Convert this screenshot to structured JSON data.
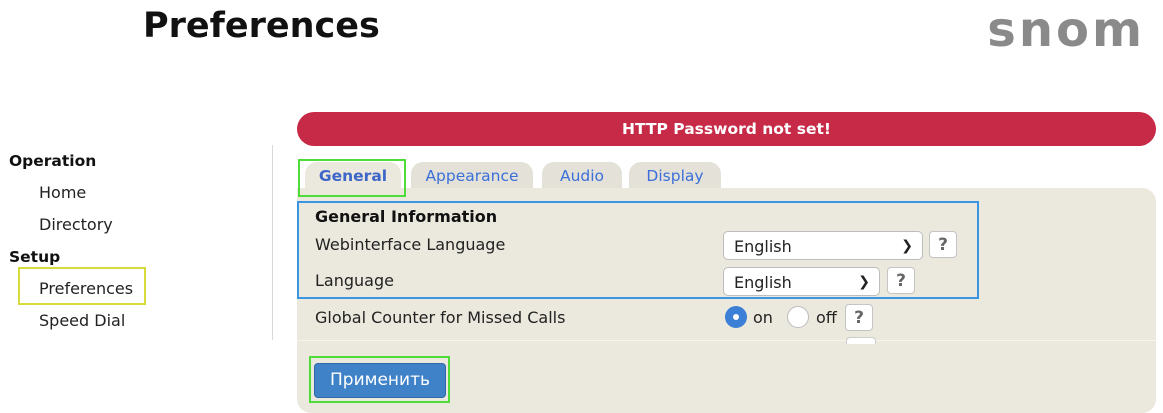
{
  "header": {
    "title": "Preferences",
    "logo_text": "snom"
  },
  "sidebar": {
    "section_operation": "Operation",
    "item_home": "Home",
    "item_directory": "Directory",
    "section_setup": "Setup",
    "item_preferences": "Preferences",
    "item_speed_dial": "Speed Dial"
  },
  "alert": {
    "text": "HTTP Password not set!"
  },
  "tabs": {
    "general": "General",
    "appearance": "Appearance",
    "audio": "Audio",
    "display": "Display"
  },
  "form": {
    "section_title": "General Information",
    "webinterface_language": {
      "label": "Webinterface Language",
      "value": "English"
    },
    "language": {
      "label": "Language",
      "value": "English"
    },
    "missed_calls": {
      "label": "Global Counter for Missed Calls",
      "on_label": "on",
      "off_label": "off",
      "selected": "on"
    },
    "help_glyph": "?"
  },
  "actions": {
    "apply_label": "Применить"
  },
  "colors": {
    "alert_bg": "#c72a46",
    "panel_bg": "#ebe8dd",
    "tab_text": "#3b6fd9",
    "apply_bg": "#3f82c8",
    "highlight_green": "#4fdc3a",
    "highlight_blue": "#3b95e0",
    "highlight_yellow": "#d6dd3b"
  }
}
